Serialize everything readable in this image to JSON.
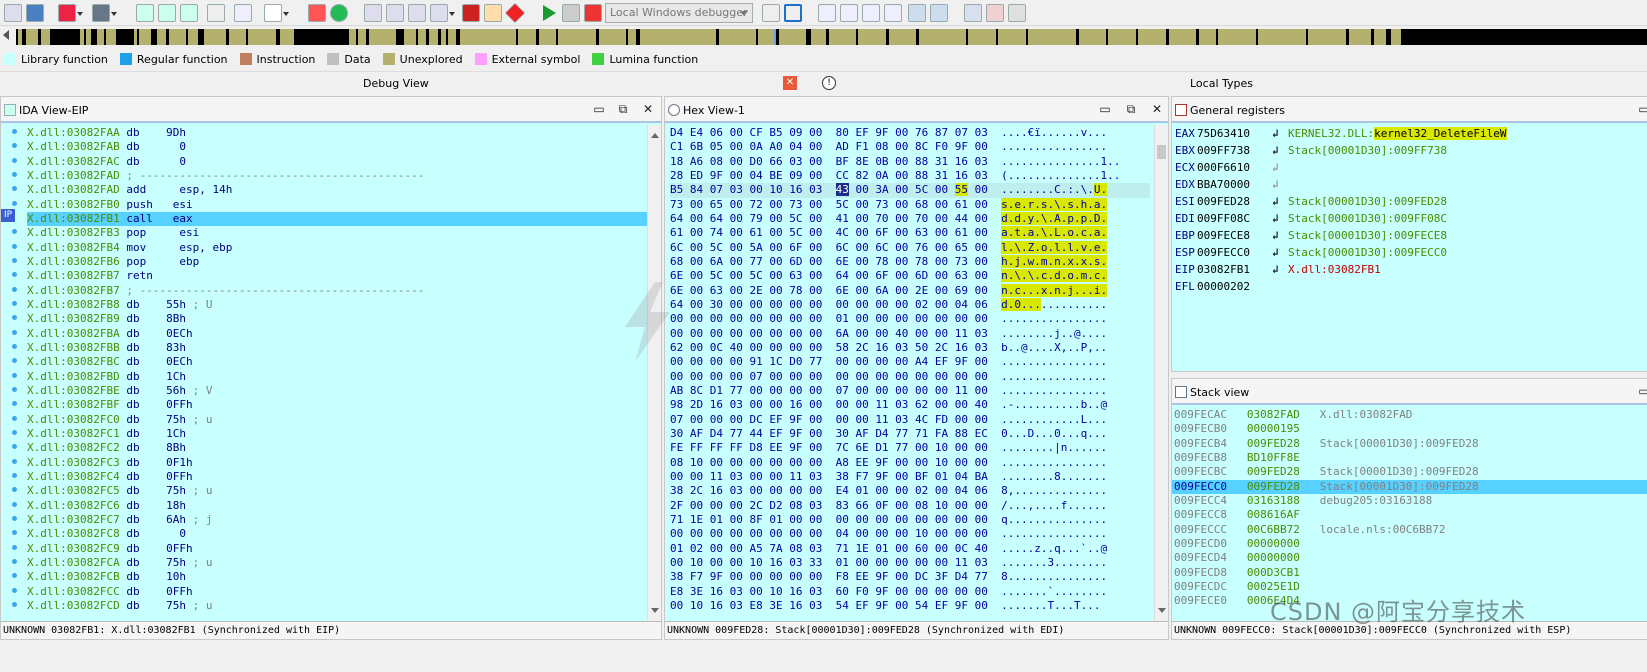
{
  "toolbar": {
    "debugger": "Local Windows debugger"
  },
  "legend": [
    {
      "label": "Library function",
      "color": "#c8ffff"
    },
    {
      "label": "Regular function",
      "color": "#1ea0e8"
    },
    {
      "label": "Instruction",
      "color": "#c08060"
    },
    {
      "label": "Data",
      "color": "#c0c0c0"
    },
    {
      "label": "Unexplored",
      "color": "#b3b16d"
    },
    {
      "label": "External symbol",
      "color": "#ffa0ff"
    },
    {
      "label": "Lumina function",
      "color": "#40d040"
    }
  ],
  "tabs": {
    "debug_view": "Debug View",
    "local_types": "Local Types"
  },
  "ida_view": {
    "title": "IDA View-EIP",
    "eip_marker": "IP",
    "status": "UNKNOWN 03082FB1: X.dll:03082FB1 (Synchronized with EIP)",
    "lines": [
      {
        "addr": "X.dll:03082FAA",
        "op": "db",
        "arg": " 9Dh",
        "cmt": ""
      },
      {
        "addr": "X.dll:03082FAB",
        "op": "db",
        "arg": "   0",
        "cmt": ""
      },
      {
        "addr": "X.dll:03082FAC",
        "op": "db",
        "arg": "   0",
        "cmt": ""
      },
      {
        "addr": "X.dll:03082FAD",
        "op": ";",
        "arg": " -------------------------------------------",
        "cmt": ""
      },
      {
        "addr": "X.dll:03082FAD",
        "op": "add",
        "arg": "   esp, 14h",
        "cmt": ""
      },
      {
        "addr": "X.dll:03082FB0",
        "op": "push",
        "arg": "  esi",
        "cmt": ""
      },
      {
        "addr": "X.dll:03082FB1",
        "op": "call",
        "arg": "  eax",
        "cmt": ""
      },
      {
        "addr": "X.dll:03082FB3",
        "op": "pop",
        "arg": "   esi",
        "cmt": ""
      },
      {
        "addr": "X.dll:03082FB4",
        "op": "mov",
        "arg": "   esp, ebp",
        "cmt": ""
      },
      {
        "addr": "X.dll:03082FB6",
        "op": "pop",
        "arg": "   ebp",
        "cmt": ""
      },
      {
        "addr": "X.dll:03082FB7",
        "op": "retn",
        "arg": "",
        "cmt": ""
      },
      {
        "addr": "X.dll:03082FB7",
        "op": ";",
        "arg": " -------------------------------------------",
        "cmt": ""
      },
      {
        "addr": "X.dll:03082FB8",
        "op": "db",
        "arg": " 55h",
        "cmt": " ; U"
      },
      {
        "addr": "X.dll:03082FB9",
        "op": "db",
        "arg": " 8Bh",
        "cmt": ""
      },
      {
        "addr": "X.dll:03082FBA",
        "op": "db",
        "arg": " 0ECh",
        "cmt": ""
      },
      {
        "addr": "X.dll:03082FBB",
        "op": "db",
        "arg": " 83h",
        "cmt": ""
      },
      {
        "addr": "X.dll:03082FBC",
        "op": "db",
        "arg": " 0ECh",
        "cmt": ""
      },
      {
        "addr": "X.dll:03082FBD",
        "op": "db",
        "arg": " 1Ch",
        "cmt": ""
      },
      {
        "addr": "X.dll:03082FBE",
        "op": "db",
        "arg": " 56h",
        "cmt": " ; V"
      },
      {
        "addr": "X.dll:03082FBF",
        "op": "db",
        "arg": " 0FFh",
        "cmt": ""
      },
      {
        "addr": "X.dll:03082FC0",
        "op": "db",
        "arg": " 75h",
        "cmt": " ; u"
      },
      {
        "addr": "X.dll:03082FC1",
        "op": "db",
        "arg": " 1Ch",
        "cmt": ""
      },
      {
        "addr": "X.dll:03082FC2",
        "op": "db",
        "arg": " 8Bh",
        "cmt": ""
      },
      {
        "addr": "X.dll:03082FC3",
        "op": "db",
        "arg": " 0F1h",
        "cmt": ""
      },
      {
        "addr": "X.dll:03082FC4",
        "op": "db",
        "arg": " 0FFh",
        "cmt": ""
      },
      {
        "addr": "X.dll:03082FC5",
        "op": "db",
        "arg": " 75h",
        "cmt": " ; u"
      },
      {
        "addr": "X.dll:03082FC6",
        "op": "db",
        "arg": " 18h",
        "cmt": ""
      },
      {
        "addr": "X.dll:03082FC7",
        "op": "db",
        "arg": " 6Ah",
        "cmt": " ; j"
      },
      {
        "addr": "X.dll:03082FC8",
        "op": "db",
        "arg": "   0",
        "cmt": ""
      },
      {
        "addr": "X.dll:03082FC9",
        "op": "db",
        "arg": " 0FFh",
        "cmt": ""
      },
      {
        "addr": "X.dll:03082FCA",
        "op": "db",
        "arg": " 75h",
        "cmt": " ; u"
      },
      {
        "addr": "X.dll:03082FCB",
        "op": "db",
        "arg": " 10h",
        "cmt": ""
      },
      {
        "addr": "X.dll:03082FCC",
        "op": "db",
        "arg": " 0FFh",
        "cmt": ""
      },
      {
        "addr": "X.dll:03082FCD",
        "op": "db",
        "arg": " 75h",
        "cmt": " ; u"
      }
    ]
  },
  "hex_view": {
    "title": "Hex View-1",
    "status": "UNKNOWN 009FED28: Stack[00001D30]:009FED28 (Synchronized with EDI)",
    "rows": [
      {
        "a": "D4 E4 06 00 CF B5 09 00",
        "b": "80 EF 9F 00 76 87 07 03",
        "s": "....€ï......v..."
      },
      {
        "a": "C1 6B 05 00 0A A0 04 00",
        "b": "AD F1 08 00 8C F0 9F 00",
        "s": "................"
      },
      {
        "a": "18 A6 08 00 D0 66 03 00",
        "b": "BF 8E 0B 00 88 31 16 03",
        "s": "...............1.."
      },
      {
        "a": "28 ED 9F 00 04 BE 09 00",
        "b": "CC 82 0A 00 88 31 16 03",
        "s": "(..............1.."
      },
      {
        "a": "B5 84 07 03 00 10 16 03",
        "b": "43 00 3A 00 5C 00 55 00",
        "s": "........C.:.\\.U."
      },
      {
        "a": "73 00 65 00 72 00 73 00",
        "b": "5C 00 73 00 68 00 61 00",
        "s": "s.e.r.s.\\.s.h.a."
      },
      {
        "a": "64 00 64 00 79 00 5C 00",
        "b": "41 00 70 00 70 00 44 00",
        "s": "d.d.y.\\.A.p.p.D."
      },
      {
        "a": "61 00 74 00 61 00 5C 00",
        "b": "4C 00 6F 00 63 00 61 00",
        "s": "a.t.a.\\.L.o.c.a."
      },
      {
        "a": "6C 00 5C 00 5A 00 6F 00",
        "b": "6C 00 6C 00 76 00 65 00",
        "s": "l.\\.Z.o.l.l.v.e."
      },
      {
        "a": "68 00 6A 00 77 00 6D 00",
        "b": "6E 00 78 00 78 00 73 00",
        "s": "h.j.w.m.n.x.x.s."
      },
      {
        "a": "6E 00 5C 00 5C 00 63 00",
        "b": "64 00 6F 00 6D 00 63 00",
        "s": "n.\\.\\.c.d.o.m.c."
      },
      {
        "a": "6E 00 63 00 2E 00 78 00",
        "b": "6E 00 6A 00 2E 00 69 00",
        "s": "n.c...x.n.j...i."
      },
      {
        "a": "64 00 30 00 00 00 00 00",
        "b": "00 00 00 00 02 00 04 06",
        "s": "d.0............."
      },
      {
        "a": "00 00 00 00 00 00 00 00",
        "b": "01 00 00 00 00 00 00 00",
        "s": "................"
      },
      {
        "a": "00 00 00 00 00 00 00 00",
        "b": "6A 00 00 40 00 00 11 03",
        "s": "........j..@...."
      },
      {
        "a": "62 00 0C 40 00 00 00 00",
        "b": "58 2C 16 03 50 2C 16 03",
        "s": "b..@....X,..P,.."
      },
      {
        "a": "00 00 00 00 91 1C D0 77",
        "b": "00 00 00 00 A4 EF 9F 00",
        "s": "................"
      },
      {
        "a": "00 00 00 00 07 00 00 00",
        "b": "00 00 00 00 00 00 00 00",
        "s": "................"
      },
      {
        "a": "AB 8C D1 77 00 00 00 00",
        "b": "07 00 00 00 00 00 11 00",
        "s": "................"
      },
      {
        "a": "98 2D 16 03 00 00 16 00",
        "b": "00 00 11 03 62 00 00 40",
        "s": ".-..........b..@"
      },
      {
        "a": "07 00 00 00 DC EF 9F 00",
        "b": "00 00 11 03 4C FD 00 00",
        "s": "............L..."
      },
      {
        "a": "30 AF D4 77 44 EF 9F 00",
        "b": "30 AF D4 77 71 FA 88 EC",
        "s": "0...D...0...q..."
      },
      {
        "a": "FE FF FF FF D8 EE 9F 00",
        "b": "7C 6E D1 77 00 10 00 00",
        "s": "........|n......"
      },
      {
        "a": "08 10 00 00 00 00 00 00",
        "b": "A8 EE 9F 00 00 10 00 00",
        "s": "................"
      },
      {
        "a": "00 00 11 03 00 00 11 03",
        "b": "38 F7 9F 00 BF 01 04 BA",
        "s": "........8......."
      },
      {
        "a": "38 2C 16 03 00 00 00 00",
        "b": "E4 01 00 00 02 00 04 06",
        "s": "8,.............."
      },
      {
        "a": "2F 00 00 00 2C D2 08 03",
        "b": "83 66 0F 00 08 10 00 00",
        "s": "/...,....f......"
      },
      {
        "a": "71 1E 01 00 8F 01 00 00",
        "b": "00 00 00 00 00 00 00 00",
        "s": "q..............."
      },
      {
        "a": "00 00 00 00 00 00 00 00",
        "b": "04 00 00 00 10 00 00 00",
        "s": "................"
      },
      {
        "a": "01 02 00 00 A5 7A 08 03",
        "b": "71 1E 01 00 60 00 0C 40",
        "s": ".....z..q...`..@"
      },
      {
        "a": "00 10 00 00 10 16 03 33",
        "b": "01 00 00 00 00 00 11 03",
        "s": ".......3........"
      },
      {
        "a": "38 F7 9F 00 00 00 00 00",
        "b": "F8 EE 9F 00 DC 3F D4 77",
        "s": "8..............."
      },
      {
        "a": "E8 3E 16 03 00 10 16 03",
        "b": "60 F0 9F 00 00 00 00 00",
        "s": ".......`........"
      },
      {
        "a": "00 10 16 03 E8 3E 16 03",
        "b": "54 EF 9F 00 54 EF 9F 00",
        "s": ".......T...T..."
      }
    ]
  },
  "registers": {
    "title": "General registers",
    "items": [
      {
        "name": "EAX",
        "value": "75D63410",
        "ref_prefix": "KERNEL32.DLL:",
        "ref": "kernel32_DeleteFileW"
      },
      {
        "name": "EBX",
        "value": "009FF738",
        "ref_prefix": "",
        "ref": "Stack[00001D30]:009FF738"
      },
      {
        "name": "ECX",
        "value": "000F6610",
        "ref_prefix": "",
        "ref": ""
      },
      {
        "name": "EDX",
        "value": "BBA70000",
        "ref_prefix": "",
        "ref": ""
      },
      {
        "name": "ESI",
        "value": "009FED28",
        "ref_prefix": "",
        "ref": "Stack[00001D30]:009FED28"
      },
      {
        "name": "EDI",
        "value": "009FF08C",
        "ref_prefix": "",
        "ref": "Stack[00001D30]:009FF08C"
      },
      {
        "name": "EBP",
        "value": "009FECE8",
        "ref_prefix": "",
        "ref": "Stack[00001D30]:009FECE8"
      },
      {
        "name": "ESP",
        "value": "009FECC0",
        "ref_prefix": "",
        "ref": "Stack[00001D30]:009FECC0"
      },
      {
        "name": "EIP",
        "value": "03082FB1",
        "ref_prefix": "",
        "ref": "X.dll:03082FB1"
      },
      {
        "name": "EFL",
        "value": "00000202",
        "ref_prefix": "",
        "ref": ""
      }
    ]
  },
  "stack_view": {
    "title": "Stack view",
    "status": "UNKNOWN 009FECC0: Stack[00001D30]:009FECC0 (Synchronized with ESP)",
    "rows": [
      {
        "addr": "009FECAC",
        "val": "03082FAD",
        "ref": "X.dll:03082FAD"
      },
      {
        "addr": "009FECB0",
        "val": "00000195",
        "ref": ""
      },
      {
        "addr": "009FECB4",
        "val": "009FED28",
        "ref": "Stack[00001D30]:009FED28"
      },
      {
        "addr": "009FECB8",
        "val": "BD10FF8E",
        "ref": ""
      },
      {
        "addr": "009FECBC",
        "val": "009FED28",
        "ref": "Stack[00001D30]:009FED28"
      },
      {
        "addr": "009FECC0",
        "val": "009FED28",
        "ref": "Stack[00001D30]:009FED28"
      },
      {
        "addr": "009FECC4",
        "val": "03163188",
        "ref": "debug205:03163188"
      },
      {
        "addr": "009FECC8",
        "val": "008616AF",
        "ref": ""
      },
      {
        "addr": "009FECCC",
        "val": "00C6BB72",
        "ref": "locale.nls:00C6BB72"
      },
      {
        "addr": "009FECD0",
        "val": "00000000",
        "ref": ""
      },
      {
        "addr": "009FECD4",
        "val": "00000000",
        "ref": ""
      },
      {
        "addr": "009FECD8",
        "val": "000D3CB1",
        "ref": ""
      },
      {
        "addr": "009FECDC",
        "val": "00025E1D",
        "ref": ""
      },
      {
        "addr": "009FECE0",
        "val": "0006E4D4",
        "ref": ""
      }
    ]
  },
  "watermark": "CSDN @阿宝分享技术"
}
